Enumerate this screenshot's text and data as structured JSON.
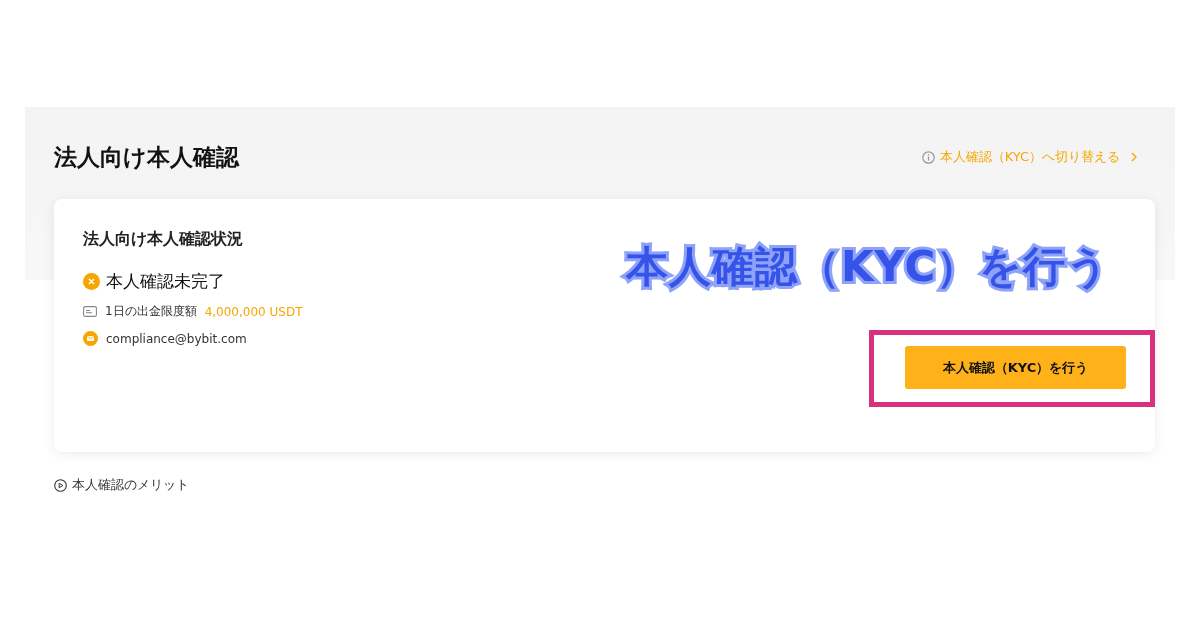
{
  "header": {
    "title": "法人向け本人確認",
    "switch_link": "本人確認（KYC）へ切り替える"
  },
  "card": {
    "title": "法人向け本人確認状況",
    "status": {
      "label": "本人確認未完了",
      "verified": false
    },
    "limit_label": "1日の出金限度額",
    "limit_value": "4,000,000 USDT",
    "email": "compliance@bybit.com",
    "button": "本人確認（KYC）を行う"
  },
  "annotation": {
    "text": "本人確認（KYC）を行う",
    "highlight": true
  },
  "benefits_link": "本人確認のメリット"
}
